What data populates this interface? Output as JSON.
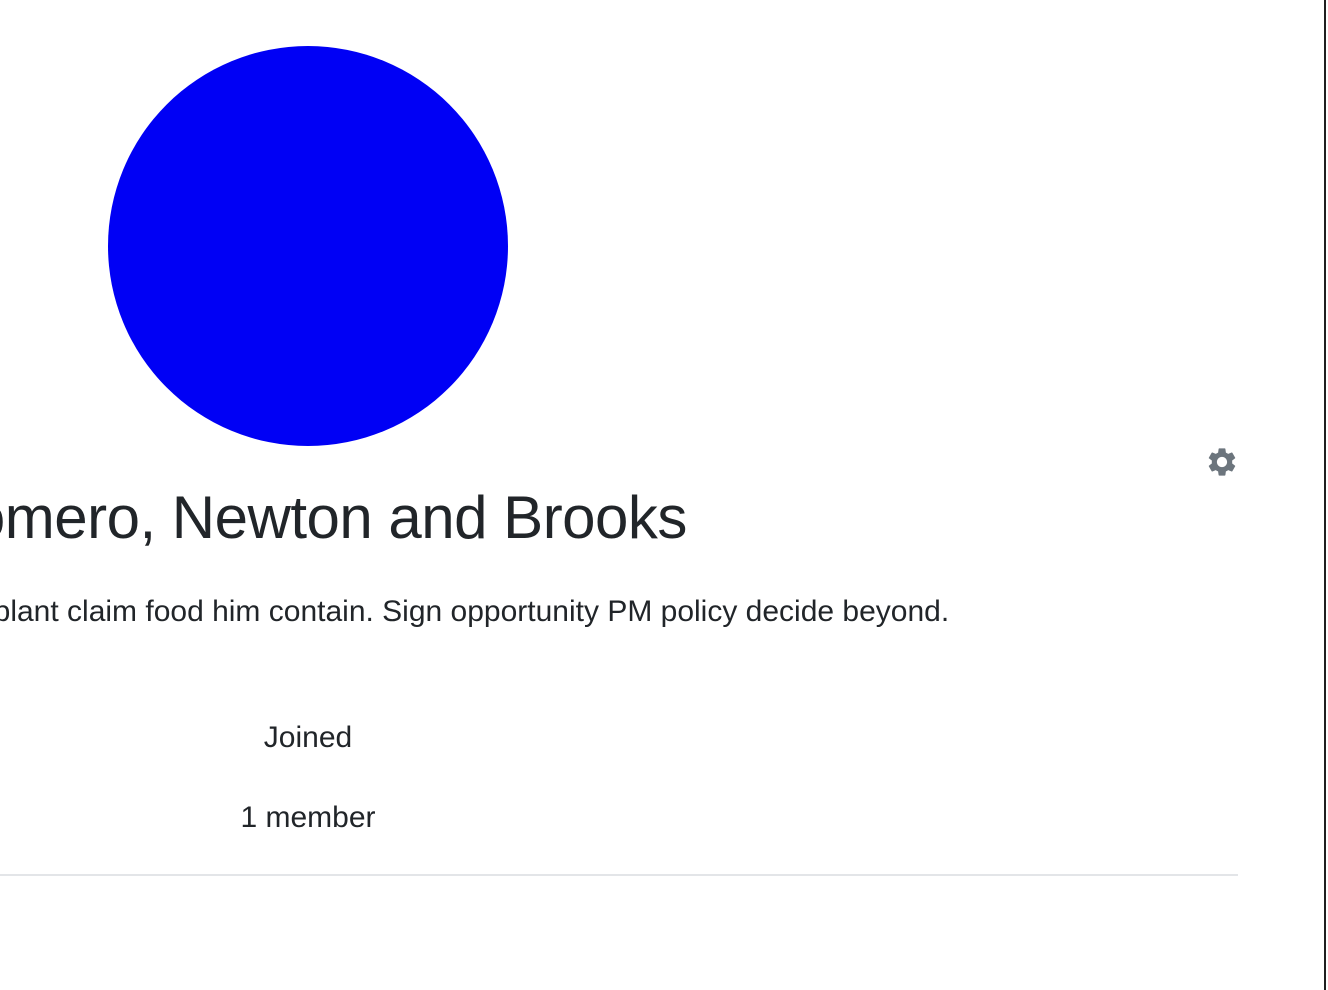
{
  "group": {
    "name": "Romero, Newton and Brooks",
    "description": "Agent successful. Other plant claim food him contain. Sign opportunity PM policy decide beyond.",
    "joined_label": "Joined",
    "members_label": "1 member",
    "avatar_color": "#0000f5"
  },
  "icons": {
    "settings": "gear-icon",
    "settings_color": "#6c757d"
  }
}
